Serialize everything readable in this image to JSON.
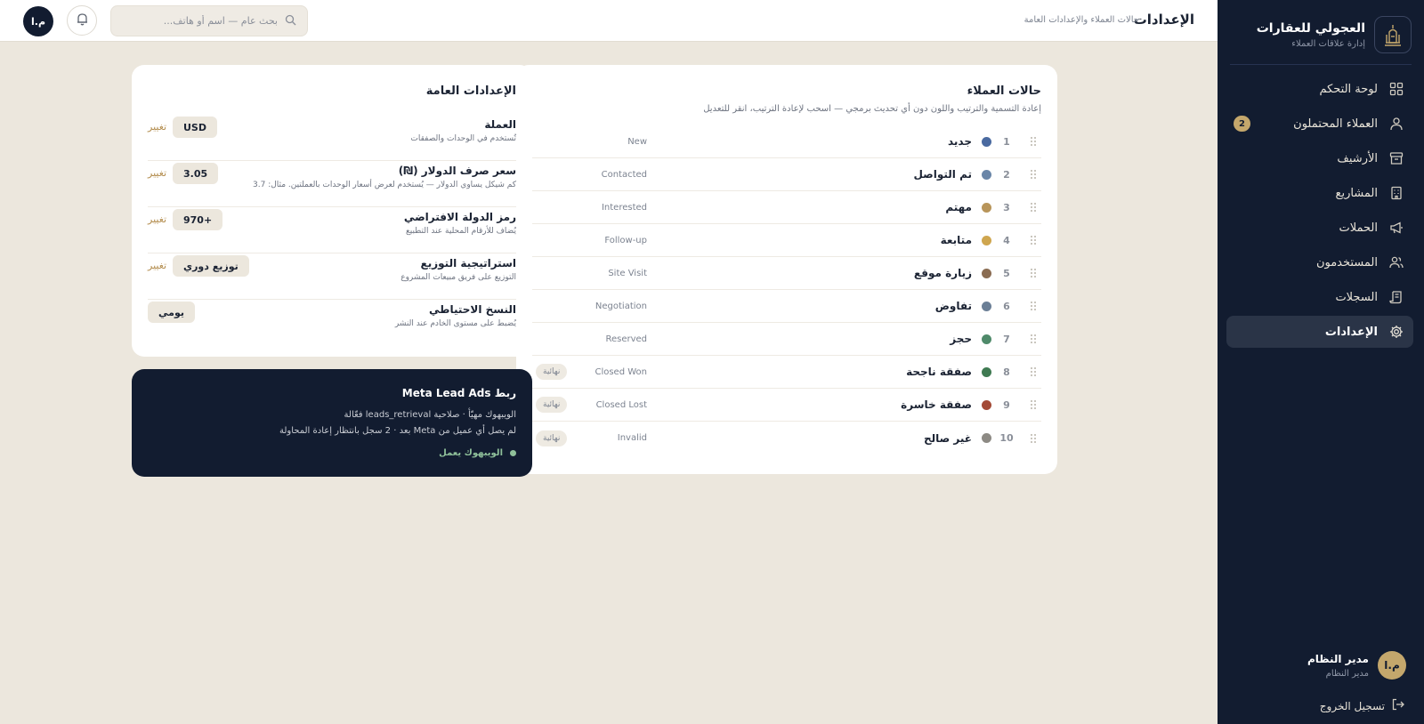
{
  "brand": {
    "name": "العجولي للعقارات",
    "subtitle": "إدارة علاقات العملاء",
    "logo_icon": "building-minaret-logo"
  },
  "nav": {
    "items": [
      {
        "label": "لوحة التحكم",
        "icon": "grid-icon"
      },
      {
        "label": "العملاء المحتملون",
        "icon": "user-icon",
        "badge": "2"
      },
      {
        "label": "الأرشيف",
        "icon": "archive-icon"
      },
      {
        "label": "المشاريع",
        "icon": "building-icon"
      },
      {
        "label": "الحملات",
        "icon": "megaphone-icon"
      },
      {
        "label": "المستخدمون",
        "icon": "users-icon"
      },
      {
        "label": "السجلات",
        "icon": "scroll-icon"
      },
      {
        "label": "الإعدادات",
        "icon": "gear-icon",
        "active": true
      }
    ]
  },
  "user": {
    "initials": "م.ا",
    "name": "مدير النظام",
    "role": "مدير النظام"
  },
  "logout_label": "تسجيل الخروج",
  "header": {
    "title": "الإعدادات",
    "subtitle": "حالات العملاء والإعدادات العامة",
    "search_placeholder": "بحث عام — اسم أو هاتف...",
    "avatar_initials": "م.ا"
  },
  "statuses": {
    "title": "حالات العملاء",
    "description": "إعادة التسمية والترتيب واللون دون أي تحديث برمجي — اسحب لإعادة الترتيب، انقر للتعديل",
    "final_label": "نهائية",
    "rows": [
      {
        "num": "1",
        "name": "جديد",
        "en": "New",
        "color": "#4a6aa0",
        "final": false
      },
      {
        "num": "2",
        "name": "تم التواصل",
        "en": "Contacted",
        "color": "#6a86a8",
        "final": false
      },
      {
        "num": "3",
        "name": "مهتم",
        "en": "Interested",
        "color": "#b8955a",
        "final": false
      },
      {
        "num": "4",
        "name": "متابعة",
        "en": "Follow-up",
        "color": "#cfa64f",
        "final": false
      },
      {
        "num": "5",
        "name": "زيارة موقع",
        "en": "Site Visit",
        "color": "#8a6c52",
        "final": false
      },
      {
        "num": "6",
        "name": "تفاوض",
        "en": "Negotiation",
        "color": "#6b7f96",
        "final": false
      },
      {
        "num": "7",
        "name": "حجز",
        "en": "Reserved",
        "color": "#4f8a6a",
        "final": false
      },
      {
        "num": "8",
        "name": "صفقة ناجحة",
        "en": "Closed Won",
        "color": "#3f7a52",
        "final": true
      },
      {
        "num": "9",
        "name": "صفقة خاسرة",
        "en": "Closed Lost",
        "color": "#a34a36",
        "final": true
      },
      {
        "num": "10",
        "name": "غير صالح",
        "en": "Invalid",
        "color": "#8d8a84",
        "final": true
      }
    ]
  },
  "general": {
    "title": "الإعدادات العامة",
    "change_label": "تغيير",
    "rows": [
      {
        "label": "العملة",
        "help": "تُستخدم في الوحدات والصفقات",
        "value": "USD",
        "changeable": true
      },
      {
        "label": "سعر صرف الدولار (₪)",
        "help": "كم شيكل يساوي الدولار — يُستخدم لعرض أسعار الوحدات بالعملتين. مثال: 3.7",
        "value": "3.05",
        "changeable": true
      },
      {
        "label": "رمز الدولة الافتراضي",
        "help": "يُضاف للأرقام المحلية عند التطبيع",
        "value": "+970",
        "changeable": true
      },
      {
        "label": "استراتيجية التوزيع",
        "help": "التوزيع على فريق مبيعات المشروع",
        "value": "توزيع دوري",
        "changeable": true
      },
      {
        "label": "النسخ الاحتياطي",
        "help": "يُضبط على مستوى الخادم عند النشر",
        "value": "يومي",
        "changeable": false
      }
    ]
  },
  "meta": {
    "title": "ربط Meta Lead Ads",
    "line1": "الويبهوك مهيّأ · صلاحية leads_retrieval فعّالة",
    "line2": "لم يصل أي عميل من Meta بعد · 2 سجل بانتظار إعادة المحاولة",
    "status": "الويبهوك يعمل"
  }
}
